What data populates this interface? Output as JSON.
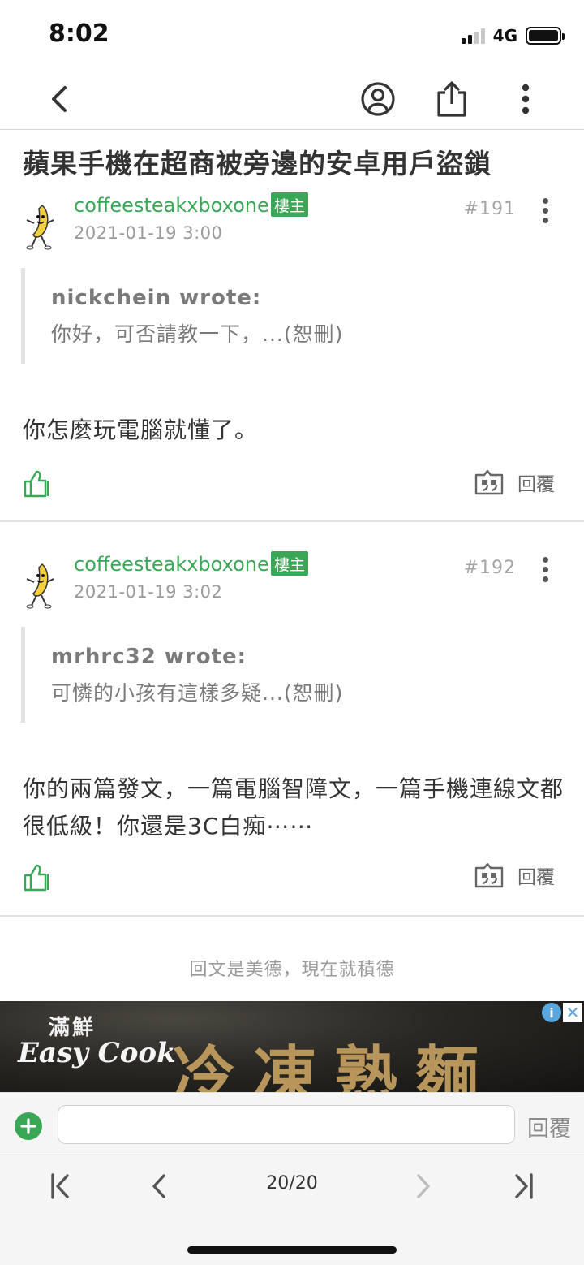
{
  "status_bar": {
    "time": "8:02",
    "network": "4G",
    "signal_bars": 2,
    "signal_total": 4
  },
  "nav": {
    "icons": [
      "back-icon",
      "profile-icon",
      "share-icon",
      "more-icon"
    ]
  },
  "thread": {
    "title": "蘋果手機在超商被旁邊的安卓用戶盜鎖",
    "posts": [
      {
        "author": "coffeesteakxboxone",
        "badge": "樓主",
        "date": "2021-01-19 3:00",
        "floor": "#191",
        "quote_author": "nickchein wrote:",
        "quote_text": "你好，可否請教一下，...(恕刪)",
        "body": "你怎麼玩電腦就懂了。",
        "reply_label": "回覆"
      },
      {
        "author": "coffeesteakxboxone",
        "badge": "樓主",
        "date": "2021-01-19 3:02",
        "floor": "#192",
        "quote_author": "mrhrc32 wrote:",
        "quote_text": "可憐的小孩有這樣多疑...(恕刪)",
        "body": "你的兩篇發文，一篇電腦智障文，一篇手機連線文都很低級！你還是3C白痴⋯⋯",
        "reply_label": "回覆"
      }
    ],
    "reply_hint": "回文是美德，現在就積德"
  },
  "ad": {
    "brand_top": "滿鮮",
    "brand": "Easy Cook",
    "product": "冷凍熟麵",
    "info_icon": "i",
    "close_icon": "✕"
  },
  "reply_bar": {
    "placeholder": "",
    "submit_label": "回覆"
  },
  "pager": {
    "indicator": "20/20"
  },
  "colors": {
    "accent": "#3aa757",
    "separator": "#e4e4e4",
    "muted_text": "#9a9a9a"
  }
}
